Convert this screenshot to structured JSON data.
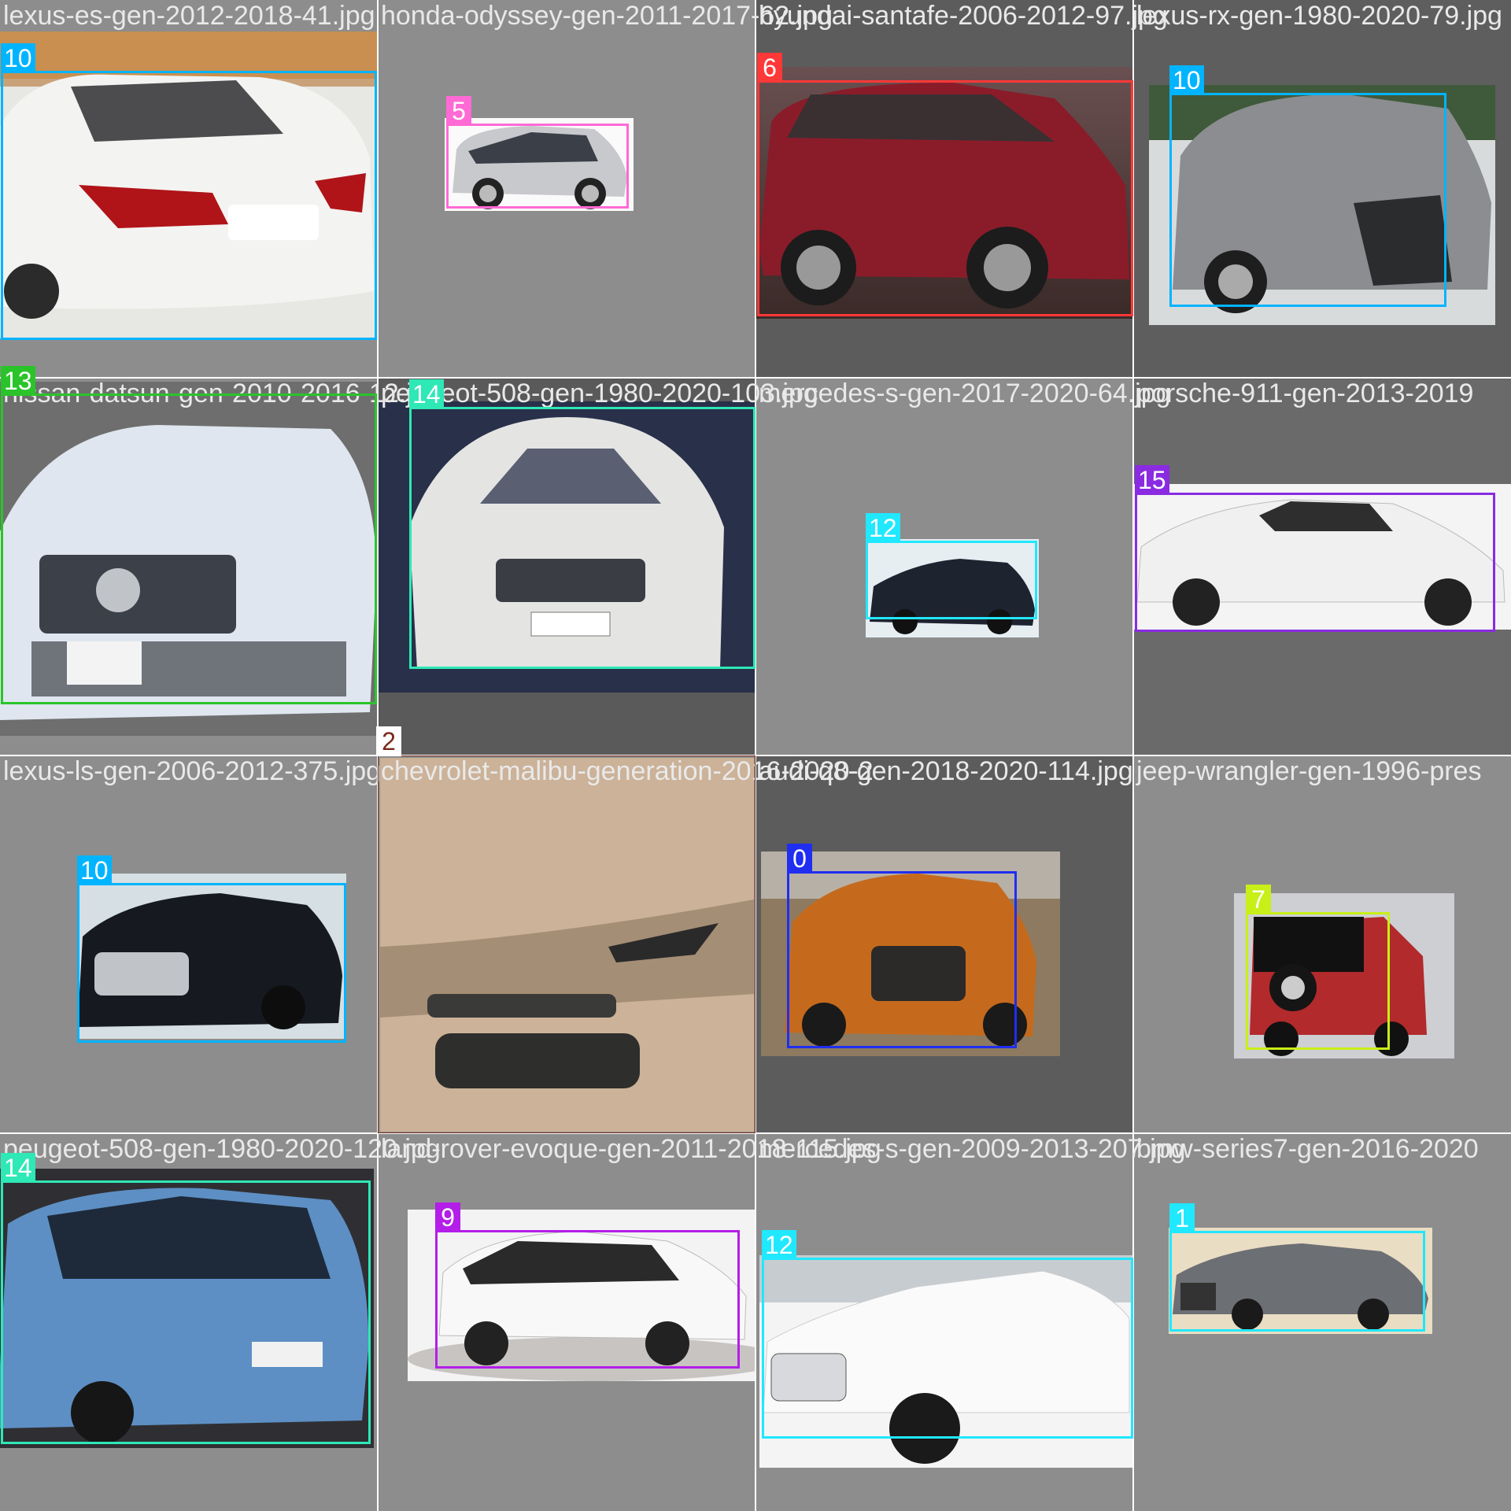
{
  "mosaic": {
    "tiles": [
      {
        "file": "lexus-es-gen-2012-2018-41.jpg",
        "class": "10",
        "color": "#00b4ff"
      },
      {
        "file": "honda-odyssey-gen-2011-2017-62.jpg",
        "class": "5",
        "color": "#ff6ad5"
      },
      {
        "file": "hyundai-santafe-2006-2012-97.jpg",
        "class": "6",
        "color": "#ff3838"
      },
      {
        "file": "lexus-rx-gen-1980-2020-79.jpg",
        "class": "10",
        "color": "#00b4ff"
      },
      {
        "file": "nissan-datsun-gen-2010-2016-12.jpg",
        "class": "13",
        "color": "#2ac42a"
      },
      {
        "file": "peugeot-508-gen-1980-2020-103.jpg",
        "class": "14",
        "color": "#2ee8b6"
      },
      {
        "file": "mercedes-s-gen-2017-2020-64.jpg",
        "class": "12",
        "color": "#20e8ff"
      },
      {
        "file": "porsche-911-gen-2013-2019",
        "class": "15",
        "color": "#8a2be2"
      },
      {
        "file": "lexus-ls-gen-2006-2012-375.jpg",
        "class": "10",
        "color": "#00b4ff"
      },
      {
        "file": "chevrolet-malibu-generation-2016-2020-2",
        "class": "2",
        "color": "#7a2a1a"
      },
      {
        "file": "audi-q8-gen-2018-2020-114.jpg",
        "class": "0",
        "color": "#1f2ef0"
      },
      {
        "file": "jeep-wrangler-gen-1996-pres",
        "class": "7",
        "color": "#c8ef17"
      },
      {
        "file": "peugeot-508-gen-1980-2020-120.jpg",
        "class": "14",
        "color": "#2ee8b6"
      },
      {
        "file": "land-rover-evoque-gen-2011-2018-115.jpg",
        "class": "9",
        "color": "#b31ee8"
      },
      {
        "file": "mercedes-s-gen-2009-2013-207.jpg",
        "class": "12",
        "color": "#20e8ff"
      },
      {
        "file": "bmw-series7-gen-2016-2020",
        "class": "1",
        "color": "#20e8ff"
      }
    ]
  }
}
